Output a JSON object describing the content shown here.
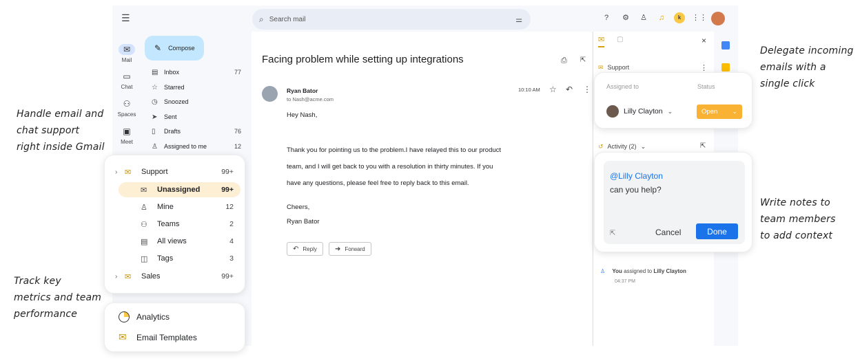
{
  "annotations": {
    "left_top": [
      "Handle email and",
      "chat support",
      "right inside Gmail"
    ],
    "left_bottom": [
      "Track key",
      "metrics and team",
      "performance"
    ],
    "right_top": [
      "Delegate incoming",
      "emails with a",
      "single click"
    ],
    "right_bottom": [
      "Write notes to",
      "team members",
      "to add context"
    ]
  },
  "gmail": {
    "search_placeholder": "Search mail",
    "compose_label": "Compose",
    "rail": [
      {
        "label": "Mail"
      },
      {
        "label": "Chat"
      },
      {
        "label": "Spaces"
      },
      {
        "label": "Meet"
      }
    ],
    "nav": [
      {
        "label": "Inbox",
        "count": "77",
        "icon": "inbox-icon"
      },
      {
        "label": "Starred",
        "count": "",
        "icon": "star-icon"
      },
      {
        "label": "Snoozed",
        "count": "",
        "icon": "clock-icon"
      },
      {
        "label": "Sent",
        "count": "",
        "icon": "send-icon"
      },
      {
        "label": "Drafts",
        "count": "76",
        "icon": "draft-icon"
      },
      {
        "label": "Assigned to me",
        "count": "12",
        "icon": "person-icon"
      }
    ]
  },
  "email": {
    "subject": "Facing problem while setting up integrations",
    "sender": "Ryan Bator",
    "to": "to Nash@acme.com",
    "time": "10:10 AM",
    "greeting": "Hey Nash,",
    "body": [
      "Thank you for pointing us to the problem.I have relayed this to our product",
      "team, and I will get back to you with a resolution in thirty minutes. If you",
      "have any questions, please feel free to reply back to this email."
    ],
    "signoff": "Cheers,",
    "signature": "Ryan Bator",
    "reply_label": "Reply",
    "forward_label": "Forward"
  },
  "sidepanel": {
    "inbox_name": "Support",
    "activity_label": "Activity (2)",
    "log_actor": "You",
    "log_action": "assigned to",
    "log_target": "Lilly Clayton",
    "log_time": "04:37 PM"
  },
  "assign_card": {
    "assigned_to_label": "Assigned to",
    "status_label": "Status",
    "assignee": "Lilly Clayton",
    "status_value": "Open",
    "status_color": "#f9b233"
  },
  "note_card": {
    "mention": "@Lilly Clayton",
    "text": "can you help?",
    "cancel_label": "Cancel",
    "done_label": "Done",
    "accent": "#1a73e8"
  },
  "nav_card": {
    "groups": [
      {
        "label": "Support",
        "count": "99+"
      },
      {
        "label": "Sales",
        "count": "99+"
      }
    ],
    "items": [
      {
        "label": "Unassigned",
        "count": "99+",
        "icon": "envelope-open-icon"
      },
      {
        "label": "Mine",
        "count": "12",
        "icon": "person-icon"
      },
      {
        "label": "Teams",
        "count": "2",
        "icon": "people-icon"
      },
      {
        "label": "All views",
        "count": "4",
        "icon": "views-icon"
      },
      {
        "label": "Tags",
        "count": "3",
        "icon": "tag-icon"
      }
    ]
  },
  "tools_card": {
    "analytics_label": "Analytics",
    "templates_label": "Email Templates"
  }
}
